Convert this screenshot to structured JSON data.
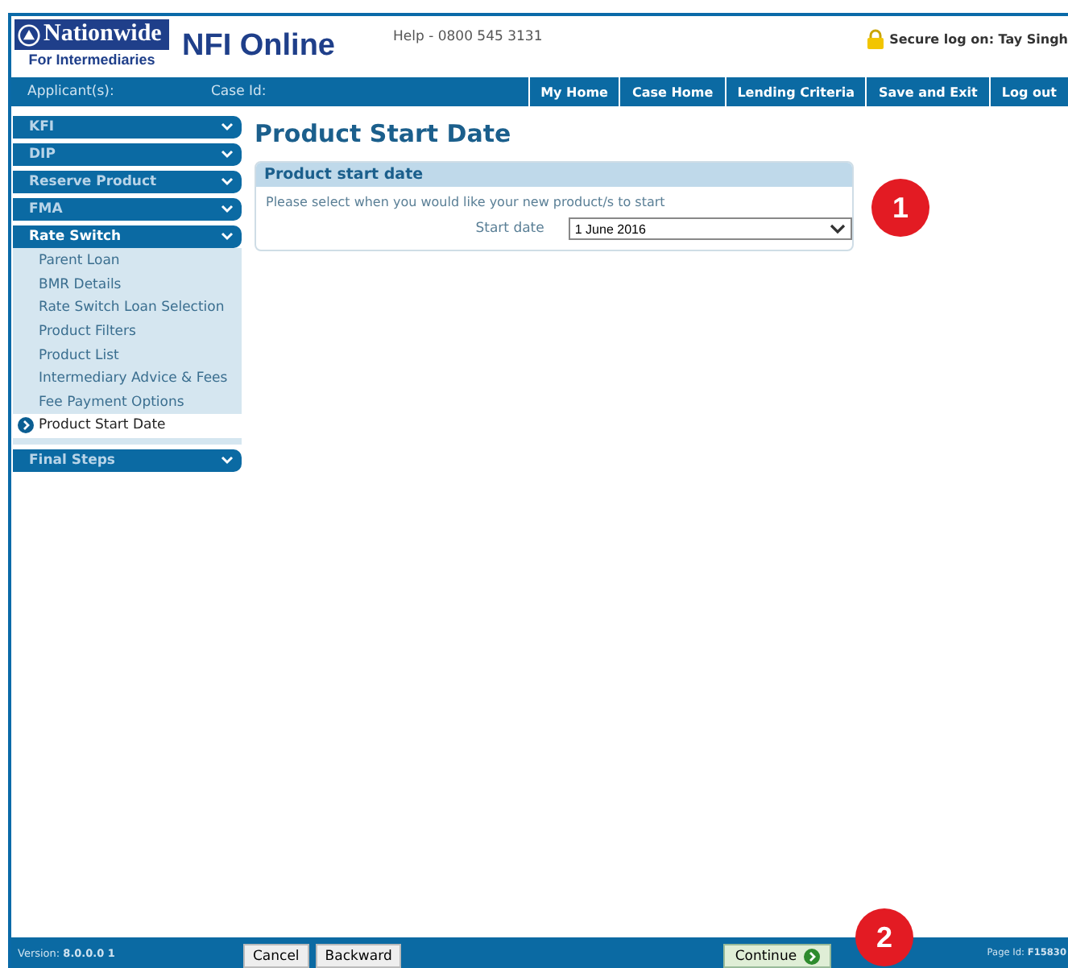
{
  "header": {
    "brand": "Nationwide",
    "brand_sub": "For Intermediaries",
    "app_title": "NFI Online",
    "help": "Help - 0800 545 3131",
    "secure": "Secure log on: Tay Singh"
  },
  "navbar": {
    "applicant_label": "Applicant(s):",
    "case_label": "Case Id:",
    "links": [
      "My Home",
      "Case Home",
      "Lending Criteria",
      "Save and Exit",
      "Log out"
    ]
  },
  "sidebar": {
    "sections": [
      {
        "label": "KFI",
        "expanded": false
      },
      {
        "label": "DIP",
        "expanded": false
      },
      {
        "label": "Reserve Product",
        "expanded": false
      },
      {
        "label": "FMA",
        "expanded": false
      },
      {
        "label": "Rate Switch",
        "expanded": true,
        "children": [
          {
            "label": "Parent Loan",
            "selected": false
          },
          {
            "label": "BMR Details",
            "selected": false
          },
          {
            "label": "Rate Switch Loan Selection",
            "selected": false
          },
          {
            "label": "Product Filters",
            "selected": false
          },
          {
            "label": "Product List",
            "selected": false
          },
          {
            "label": "Intermediary Advice & Fees",
            "selected": false
          },
          {
            "label": "Fee Payment Options",
            "selected": false
          },
          {
            "label": "Product Start Date",
            "selected": true
          }
        ]
      },
      {
        "label": "Final Steps",
        "expanded": false
      }
    ]
  },
  "page_title": "Product Start Date",
  "panel": {
    "title": "Product start date",
    "instruction": "Please select when you would like your new product/s to start",
    "field_label": "Start date",
    "field_value": "1 June 2016"
  },
  "footer": {
    "version": "Version: **8.0.0.0 1**",
    "buttons": [
      "Cancel",
      "Backward"
    ],
    "continue": "Continue",
    "page_id": "Page Id: **F15830**"
  },
  "callouts": [
    "1",
    "2"
  ]
}
